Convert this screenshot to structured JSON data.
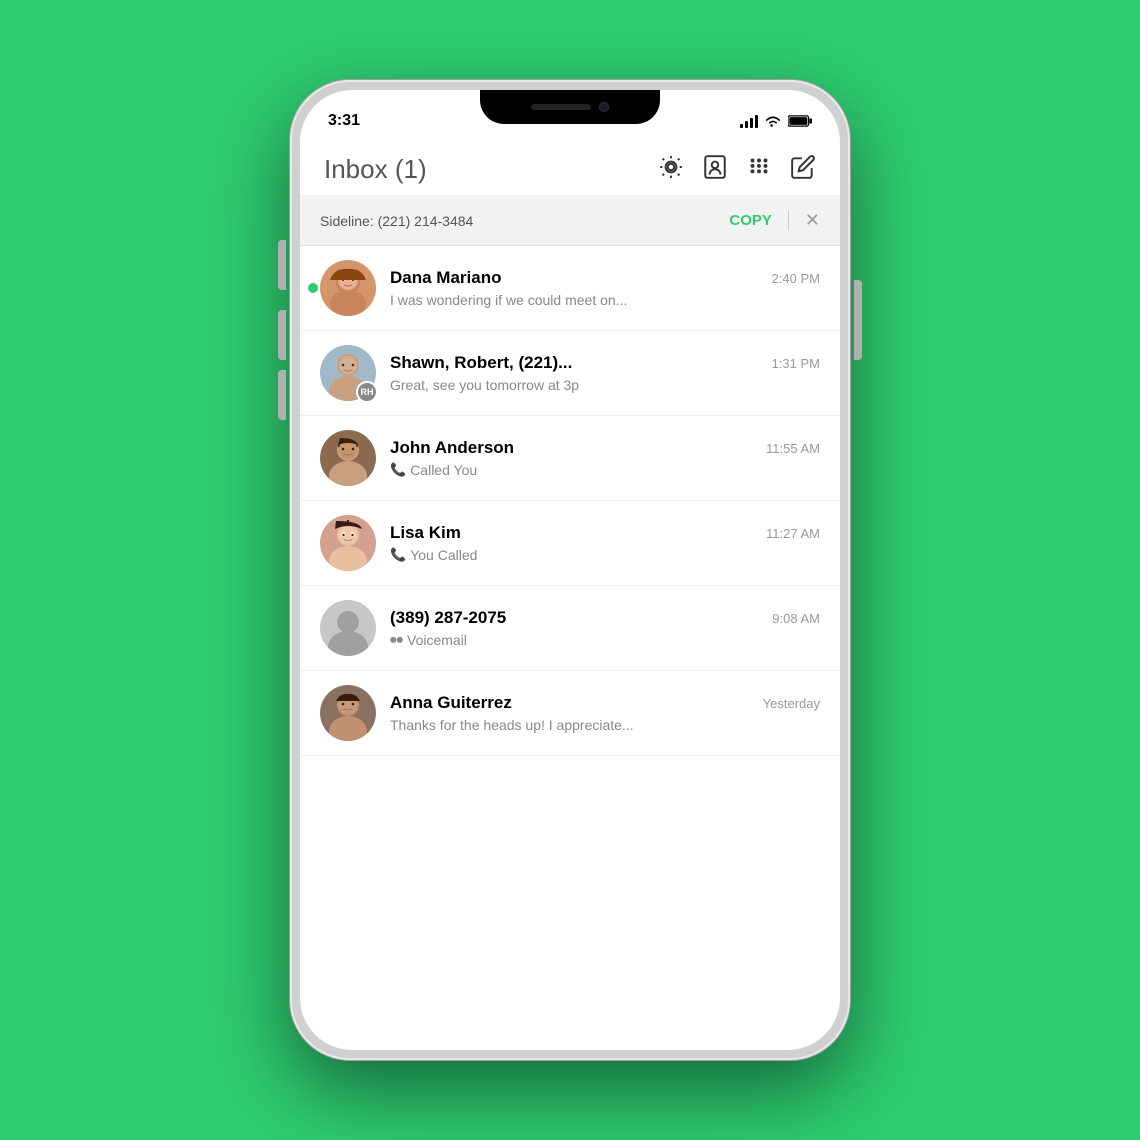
{
  "background_color": "#2ecc71",
  "phone": {
    "status_bar": {
      "time": "3:31",
      "signal_bars": 4,
      "wifi": true,
      "battery": "full"
    },
    "header": {
      "title": "Inbox",
      "unread_count": "(1)",
      "icons": [
        "settings",
        "contacts",
        "dialpad",
        "compose"
      ]
    },
    "sideline_banner": {
      "label": "Sideline: (221) 214-3484",
      "copy_label": "COPY",
      "close": "×"
    },
    "conversations": [
      {
        "id": "dana",
        "name": "Dana Mariano",
        "timestamp": "2:40 PM",
        "preview": "I was wondering if we could meet on...",
        "unread": true,
        "type": "message",
        "avatar_type": "photo",
        "avatar_color": "#d4956a"
      },
      {
        "id": "shawn",
        "name": "Shawn, Robert, (221)...",
        "timestamp": "1:31 PM",
        "preview": "Great, see you tomorrow at 3p",
        "unread": false,
        "type": "message",
        "avatar_type": "photo",
        "avatar_initials": "RH",
        "avatar_color": "#a0b8c8"
      },
      {
        "id": "john",
        "name": "John Anderson",
        "timestamp": "11:55 AM",
        "preview": "Called You",
        "unread": false,
        "type": "call_received",
        "avatar_type": "photo",
        "avatar_color": "#8b6a50"
      },
      {
        "id": "lisa",
        "name": "Lisa Kim",
        "timestamp": "11:27 AM",
        "preview": "You Called",
        "unread": false,
        "type": "call_made",
        "avatar_type": "photo",
        "avatar_color": "#d4a090"
      },
      {
        "id": "unknown",
        "name": "(389) 287-2075",
        "timestamp": "9:08 AM",
        "preview": "Voicemail",
        "unread": false,
        "type": "voicemail",
        "avatar_type": "generic",
        "avatar_color": "#c0c0c0"
      },
      {
        "id": "anna",
        "name": "Anna Guiterrez",
        "timestamp": "Yesterday",
        "preview": "Thanks for the heads up! I appreciate...",
        "unread": false,
        "type": "message",
        "avatar_type": "photo",
        "avatar_color": "#8a7060"
      }
    ]
  }
}
